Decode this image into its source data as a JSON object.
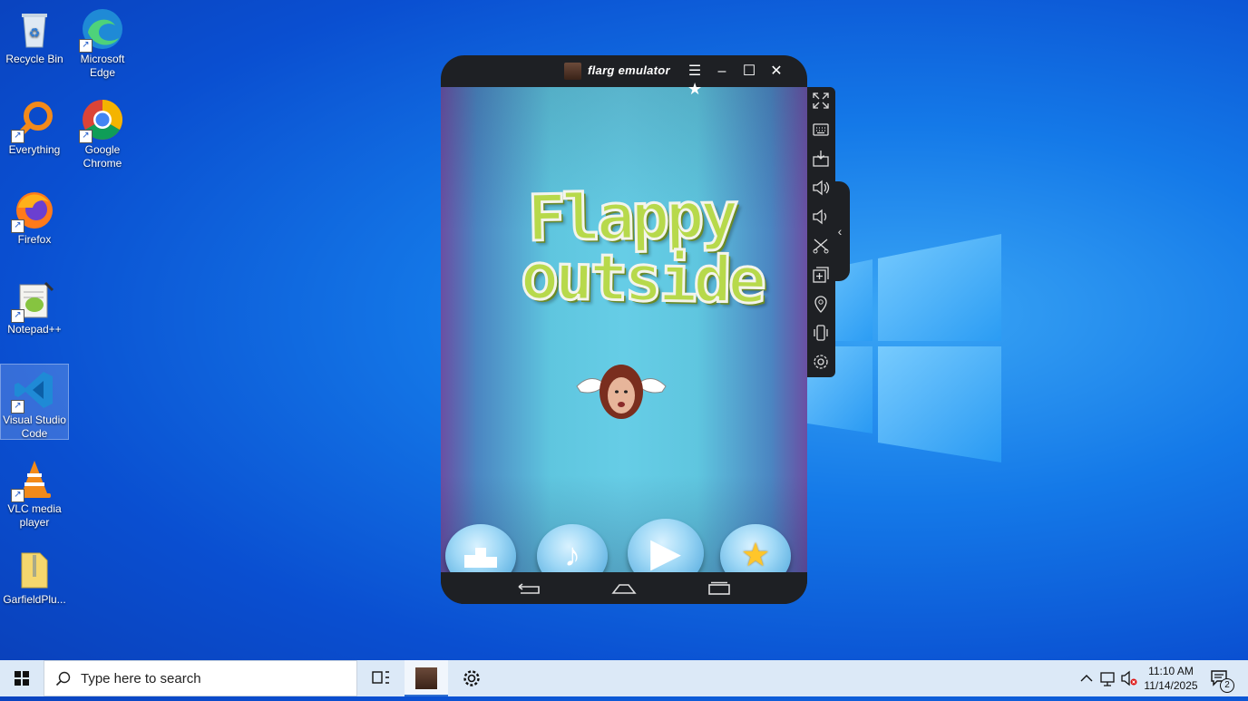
{
  "desktop": {
    "icons": [
      {
        "label": "Recycle Bin"
      },
      {
        "label": "Microsoft Edge"
      },
      {
        "label": "Everything"
      },
      {
        "label": "Google Chrome"
      },
      {
        "label": "Firefox"
      },
      {
        "label": "Notepad++"
      },
      {
        "label": "Visual Studio Code"
      },
      {
        "label": "VLC media player"
      },
      {
        "label": "GarfieldPlu..."
      }
    ]
  },
  "emulator": {
    "title": "flarg emulator",
    "game": {
      "title_line1": "Flappy",
      "title_line2": "outside"
    },
    "side_toolbar": [
      "fullscreen-icon",
      "keyboard-icon",
      "apk-install-icon",
      "volume-up-icon",
      "volume-down-icon",
      "screenshot-cut-icon",
      "multi-instance-icon",
      "location-icon",
      "shake-icon",
      "settings-icon"
    ]
  },
  "taskbar": {
    "search_placeholder": "Type here to search",
    "time": "11:10 AM",
    "date": "11/14/2025",
    "notification_count": "2"
  },
  "colors": {
    "title_green": "#b7d94b",
    "emulator_frame": "#1e2024",
    "taskbar": "#dce9f7"
  }
}
